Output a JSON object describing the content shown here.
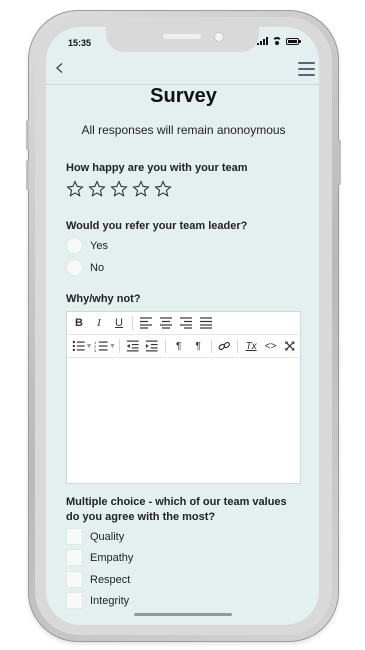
{
  "status": {
    "time": "15:35"
  },
  "header": {
    "back_icon": "chevron-left-icon",
    "menu_icon": "hamburger-menu-icon"
  },
  "page": {
    "title": "Survey",
    "subtitle": "All responses will remain anonoymous"
  },
  "questions": {
    "happiness": {
      "label": "How happy are you with your team",
      "rating_max": 5,
      "rating_value": 0
    },
    "refer": {
      "label": "Would you refer your team leader?",
      "options": [
        "Yes",
        "No"
      ]
    },
    "why": {
      "label": "Why/why not?",
      "value": ""
    },
    "values": {
      "label": "Multiple choice - which of our team values do you agree with the most?",
      "options": [
        "Quality",
        "Empathy",
        "Respect",
        "Integrity"
      ]
    }
  },
  "editor_toolbar": {
    "bold": "B",
    "italic": "I",
    "underline": "U",
    "ltr": "¶",
    "rtl": "¶",
    "clear_format": "Tx",
    "source": "<>"
  },
  "colors": {
    "screen_bg": "#e4f0ef",
    "accent": "#5b6478"
  }
}
